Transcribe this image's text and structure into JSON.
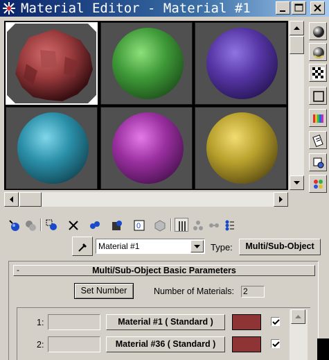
{
  "window": {
    "title": "Material Editor - Material #1",
    "controls": [
      "minimize",
      "maximize",
      "close"
    ]
  },
  "sample_slots": [
    {
      "material": "Material #1",
      "color": "#8f3a3c",
      "active": true,
      "shape": "noisy-sphere"
    },
    {
      "material": "green",
      "color": "#3f9a38",
      "active": false
    },
    {
      "material": "purple",
      "color": "#5736a6",
      "active": false
    },
    {
      "material": "teal",
      "color": "#2a8fa8",
      "active": false
    },
    {
      "material": "magenta",
      "color": "#9a2fa0",
      "active": false
    },
    {
      "material": "yellow",
      "color": "#b8a02c",
      "active": false
    }
  ],
  "right_toolbar": [
    "sample-type-sphere-icon",
    "backlight-icon",
    "background-checker-icon",
    "sample-uv-tiling-icon",
    "video-color-check-icon",
    "make-preview-icon",
    "options-icon",
    "select-by-material-icon"
  ],
  "lower_toolbar": [
    "get-material-icon",
    "put-to-scene-icon",
    "assign-to-selection-icon",
    "reset-map-icon",
    "make-unique-icon",
    "put-to-library-icon",
    "material-effects-channel-icon",
    "show-map-in-viewport-icon",
    "show-end-result-icon",
    "go-to-parent-icon",
    "go-forward-to-sibling-icon",
    "material-map-navigator-icon"
  ],
  "name_row": {
    "material_name": "Material #1",
    "type_label": "Type:",
    "type_value": "Multi/Sub-Object"
  },
  "rollout": {
    "toggle": "-",
    "title": "Multi/Sub-Object Basic Parameters",
    "set_number_label": "Set Number",
    "num_materials_label": "Number of Materials:",
    "num_materials_value": "2"
  },
  "submaterials": [
    {
      "index": "1:",
      "name": "",
      "material": "Material #1   ( Standard )",
      "color": "#8f3434",
      "enabled": true
    },
    {
      "index": "2:",
      "name": "",
      "material": "Material #36   ( Standard )",
      "color": "#8f3434",
      "enabled": true
    }
  ]
}
